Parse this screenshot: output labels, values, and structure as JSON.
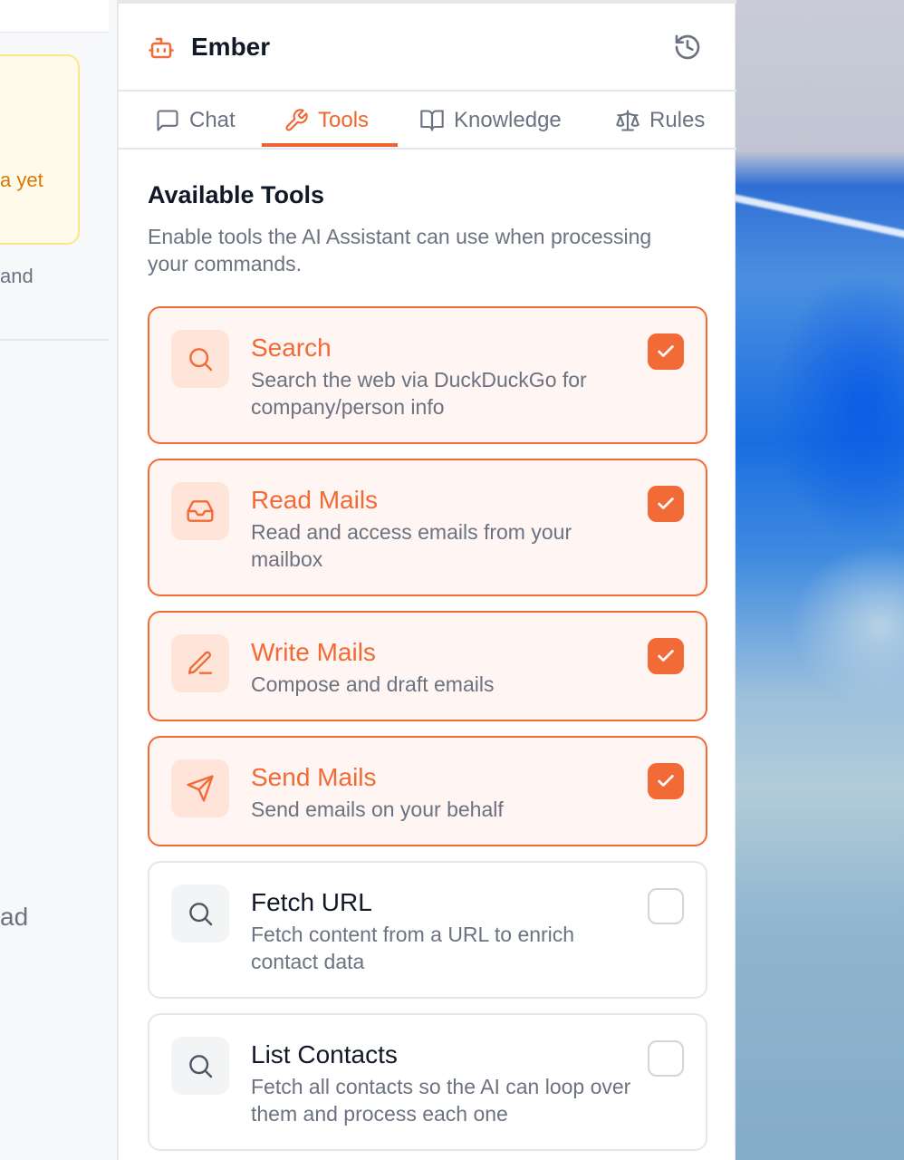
{
  "left_pane": {
    "card_text": "a yet",
    "and_text": "and",
    "ad_text": "ad"
  },
  "header": {
    "title": "Ember",
    "icons": {
      "logo": "robot-icon",
      "history": "history-icon"
    }
  },
  "tabs": [
    {
      "label": "Chat",
      "icon": "message-square-icon",
      "active": false
    },
    {
      "label": "Tools",
      "icon": "wrench-icon",
      "active": true
    },
    {
      "label": "Knowledge",
      "icon": "book-open-icon",
      "active": false
    },
    {
      "label": "Rules",
      "icon": "scale-icon",
      "active": false
    }
  ],
  "section": {
    "title": "Available Tools",
    "description": "Enable tools the AI Assistant can use when processing your commands."
  },
  "tools": [
    {
      "name": "Search",
      "description": "Search the web via DuckDuckGo for company/person info",
      "icon": "search-icon",
      "enabled": true
    },
    {
      "name": "Read Mails",
      "description": "Read and access emails from your mailbox",
      "icon": "inbox-icon",
      "enabled": true
    },
    {
      "name": "Write Mails",
      "description": "Compose and draft emails",
      "icon": "pen-icon",
      "enabled": true
    },
    {
      "name": "Send Mails",
      "description": "Send emails on your behalf",
      "icon": "send-icon",
      "enabled": true
    },
    {
      "name": "Fetch URL",
      "description": "Fetch content from a URL to enrich contact data",
      "icon": "search-icon",
      "enabled": false
    },
    {
      "name": "List Contacts",
      "description": "Fetch all contacts so the AI can loop over them and process each one",
      "icon": "search-icon",
      "enabled": false
    }
  ],
  "colors": {
    "accent": "#f26a35",
    "accent_bg": "#fff5f2",
    "text": "#111827",
    "muted": "#6b7280"
  }
}
